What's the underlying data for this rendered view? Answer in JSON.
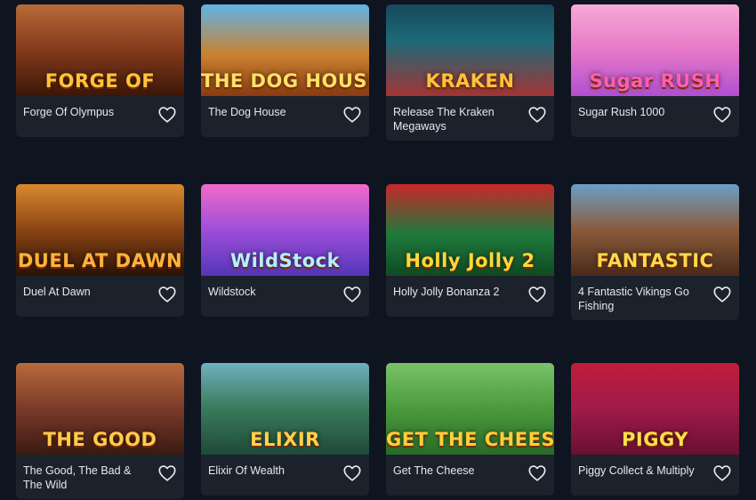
{
  "games": [
    {
      "name": "Forge Of Olympus",
      "art_text": "FORGE OF",
      "bg": "linear-gradient(180deg,#b86a38 0%,#8a3e1e 45%,#3b1608 100%)",
      "art_color": "#ffc43a"
    },
    {
      "name": "The Dog House",
      "art_text": "THE DOG HOUSE",
      "bg": "linear-gradient(180deg,#5fb4e8 0%,#c9822e 55%,#8a3b12 100%)",
      "art_color": "#ffe066"
    },
    {
      "name": "Release The Kraken Megaways",
      "art_text": "KRAKEN",
      "bg": "linear-gradient(180deg,#16485a 0%,#1d6a78 40%,#a33434 100%)",
      "art_color": "#ffc13b"
    },
    {
      "name": "Sugar Rush 1000",
      "art_text": "Sugar RUSH",
      "bg": "linear-gradient(180deg,#f7a9d8 0%,#e679c7 50%,#b04fd1 100%)",
      "art_color": "#ff5fae"
    },
    {
      "name": "Duel At Dawn",
      "art_text": "DUEL AT DAWN",
      "bg": "linear-gradient(180deg,#d98a2e 0%,#8a4414 50%,#2a1206 100%)",
      "art_color": "#ffb23a"
    },
    {
      "name": "Wildstock",
      "art_text": "WildStock",
      "bg": "linear-gradient(180deg,#f26acb 0%,#9d4ed8 50%,#5436b8 100%)",
      "art_color": "#b4f0ff"
    },
    {
      "name": "Holly Jolly Bonanza 2",
      "art_text": "Holly Jolly 2",
      "bg": "linear-gradient(180deg,#c8282a 0%,#1f7a3c 55%,#0f4a24 100%)",
      "art_color": "#ffd83a"
    },
    {
      "name": "4 Fantastic Vikings Go Fishing",
      "art_text": "FANTASTIC",
      "bg": "linear-gradient(180deg,#6aa0c4 0%,#8a5a3a 50%,#4a2a1a 100%)",
      "art_color": "#ffd84a"
    },
    {
      "name": "The Good, The Bad & The Wild",
      "art_text": "THE GOOD",
      "bg": "linear-gradient(180deg,#b86a3a 0%,#7a3a2a 50%,#3a1a12 100%)",
      "art_color": "#ffcc4a"
    },
    {
      "name": "Elixir Of Wealth",
      "art_text": "ELIXIR",
      "bg": "linear-gradient(180deg,#6fb0c0 0%,#3a7a5a 50%,#1e4a3a 100%)",
      "art_color": "#ffd24a"
    },
    {
      "name": "Get The Cheese",
      "art_text": "GET THE CHEESE",
      "bg": "linear-gradient(180deg,#7ac26a 0%,#4a9a3a 50%,#2a6a2a 100%)",
      "art_color": "#ffcf3a"
    },
    {
      "name": "Piggy Collect & Multiply",
      "art_text": "PIGGY",
      "bg": "linear-gradient(180deg,#c01e3a 0%,#a01a4a 50%,#6a1030 100%)",
      "art_color": "#ffe04a"
    }
  ],
  "colors": {
    "page_bg": "#0e1420",
    "card_bg": "#1c222c",
    "text": "#e6e8ec"
  },
  "icons": {
    "favorite": "heart-icon"
  }
}
